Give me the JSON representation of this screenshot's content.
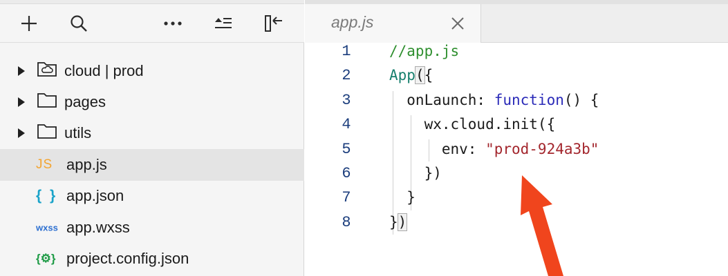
{
  "sidebar": {
    "toolbar": {
      "add": "plus-icon",
      "search": "search-icon",
      "more": "more-icon",
      "collapse": "collapse-all-icon",
      "toggle": "toggle-panel-icon"
    },
    "tree": [
      {
        "label": "cloud | prod",
        "kind": "cloud-folder",
        "expanded": false
      },
      {
        "label": "pages",
        "kind": "folder",
        "expanded": false
      },
      {
        "label": "utils",
        "kind": "folder",
        "expanded": false
      },
      {
        "label": "app.js",
        "kind": "js",
        "icon_text": "JS",
        "selected": true
      },
      {
        "label": "app.json",
        "kind": "json",
        "icon_text": "{ }"
      },
      {
        "label": "app.wxss",
        "kind": "wxss",
        "icon_text": "wxss"
      },
      {
        "label": "project.config.json",
        "kind": "config",
        "icon_text": "{⚙}"
      }
    ]
  },
  "editor": {
    "active_tab": "app.js",
    "lines": [
      {
        "n": "1",
        "parts": [
          [
            "//app.js",
            "cm"
          ]
        ]
      },
      {
        "n": "2",
        "parts": [
          [
            "App",
            "id"
          ],
          [
            "(",
            "bx"
          ],
          [
            "{",
            ""
          ]
        ]
      },
      {
        "n": "3",
        "parts": [
          [
            "  onLaunch: ",
            ""
          ],
          [
            "function",
            "kw"
          ],
          [
            "() {",
            ""
          ]
        ]
      },
      {
        "n": "4",
        "parts": [
          [
            "    wx.cloud.init({",
            ""
          ]
        ]
      },
      {
        "n": "5",
        "parts": [
          [
            "      env: ",
            ""
          ],
          [
            "\"prod-924a3b\"",
            "st"
          ]
        ]
      },
      {
        "n": "6",
        "parts": [
          [
            "    })",
            ""
          ]
        ]
      },
      {
        "n": "7",
        "parts": [
          [
            "  }",
            ""
          ]
        ]
      },
      {
        "n": "8",
        "parts": [
          [
            "}",
            ""
          ],
          [
            ")",
            "bx"
          ]
        ]
      }
    ]
  },
  "colors": {
    "arrow": "#f0451d",
    "selected_row": "#e4e4e4",
    "comment": "#2f8f2f",
    "keyword": "#2a2ab8",
    "string": "#a3262d"
  }
}
